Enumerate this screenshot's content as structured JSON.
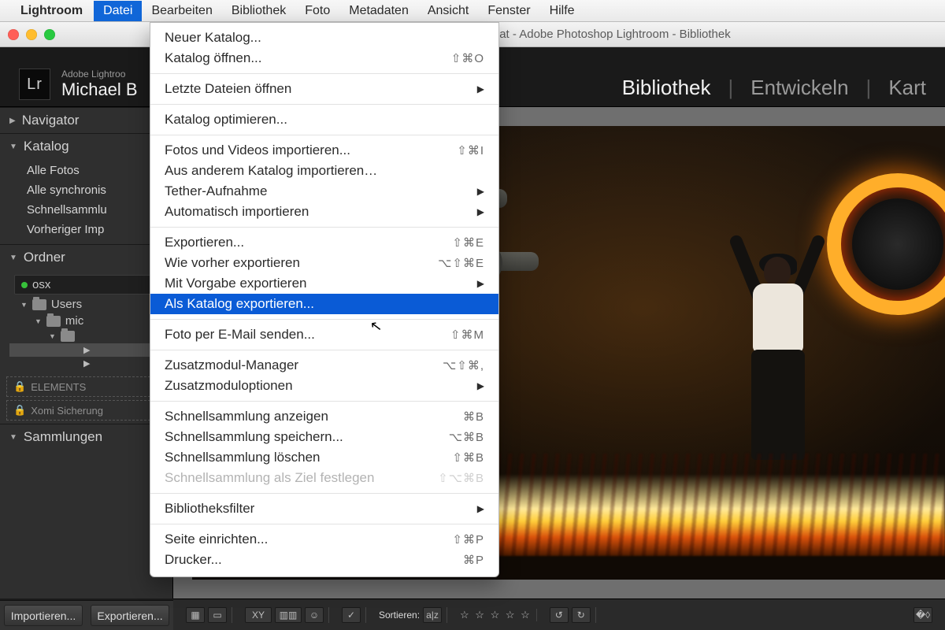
{
  "menubar": {
    "app": "Lightroom",
    "items": [
      "Datei",
      "Bearbeiten",
      "Bibliothek",
      "Foto",
      "Metadaten",
      "Ansicht",
      "Fenster",
      "Hilfe"
    ],
    "active_index": 0
  },
  "window": {
    "title": "troom Catalog.lrcat - Adobe Photoshop Lightroom - Bibliothek"
  },
  "lightroom": {
    "brand_small": "Adobe Lightroo",
    "identity": "Michael B",
    "logo": "Lr",
    "modules": {
      "library": "Bibliothek",
      "develop": "Entwickeln",
      "map": "Kart"
    }
  },
  "left_panel": {
    "navigator": "Navigator",
    "catalog": {
      "title": "Katalog",
      "items": [
        "Alle Fotos",
        "Alle synchronis",
        "Schnellsammlu",
        "Vorheriger Imp"
      ]
    },
    "folders": {
      "title": "Ordner",
      "volume": "osx",
      "tree": [
        "Users",
        "mic"
      ]
    },
    "locked": [
      "ELEMENTS",
      "Xomi Sicherung"
    ],
    "collections": "Sammlungen",
    "buttons": {
      "import": "Importieren...",
      "export": "Exportieren..."
    }
  },
  "toolbar": {
    "sort_label": "Sortieren:",
    "stars": "☆ ☆ ☆ ☆ ☆"
  },
  "dropdown": {
    "items": [
      {
        "label": "Neuer Katalog...",
        "sc": ""
      },
      {
        "label": "Katalog öffnen...",
        "sc": "⇧⌘O"
      },
      {
        "sep": true
      },
      {
        "label": "Letzte Dateien öffnen",
        "sub": true
      },
      {
        "sep": true
      },
      {
        "label": "Katalog optimieren...",
        "sc": ""
      },
      {
        "sep": true
      },
      {
        "label": "Fotos und Videos importieren...",
        "sc": "⇧⌘I"
      },
      {
        "label": "Aus anderem Katalog importieren…",
        "sc": ""
      },
      {
        "label": "Tether-Aufnahme",
        "sub": true
      },
      {
        "label": "Automatisch importieren",
        "sub": true
      },
      {
        "sep": true
      },
      {
        "label": "Exportieren...",
        "sc": "⇧⌘E"
      },
      {
        "label": "Wie vorher exportieren",
        "sc": "⌥⇧⌘E"
      },
      {
        "label": "Mit Vorgabe exportieren",
        "sub": true
      },
      {
        "label": "Als Katalog exportieren...",
        "hl": true
      },
      {
        "sep": true
      },
      {
        "label": "Foto per E-Mail senden...",
        "sc": "⇧⌘M"
      },
      {
        "sep": true
      },
      {
        "label": "Zusatzmodul-Manager",
        "sc": "⌥⇧⌘,"
      },
      {
        "label": "Zusatzmoduloptionen",
        "sub": true
      },
      {
        "sep": true
      },
      {
        "label": "Schnellsammlung anzeigen",
        "sc": "⌘B"
      },
      {
        "label": "Schnellsammlung speichern...",
        "sc": "⌥⌘B"
      },
      {
        "label": "Schnellsammlung löschen",
        "sc": "⇧⌘B"
      },
      {
        "label": "Schnellsammlung als Ziel festlegen",
        "sc": "⇧⌥⌘B",
        "disabled": true
      },
      {
        "sep": true
      },
      {
        "label": "Bibliotheksfilter",
        "sub": true
      },
      {
        "sep": true
      },
      {
        "label": "Seite einrichten...",
        "sc": "⇧⌘P"
      },
      {
        "label": "Drucker...",
        "sc": "⌘P"
      }
    ]
  }
}
